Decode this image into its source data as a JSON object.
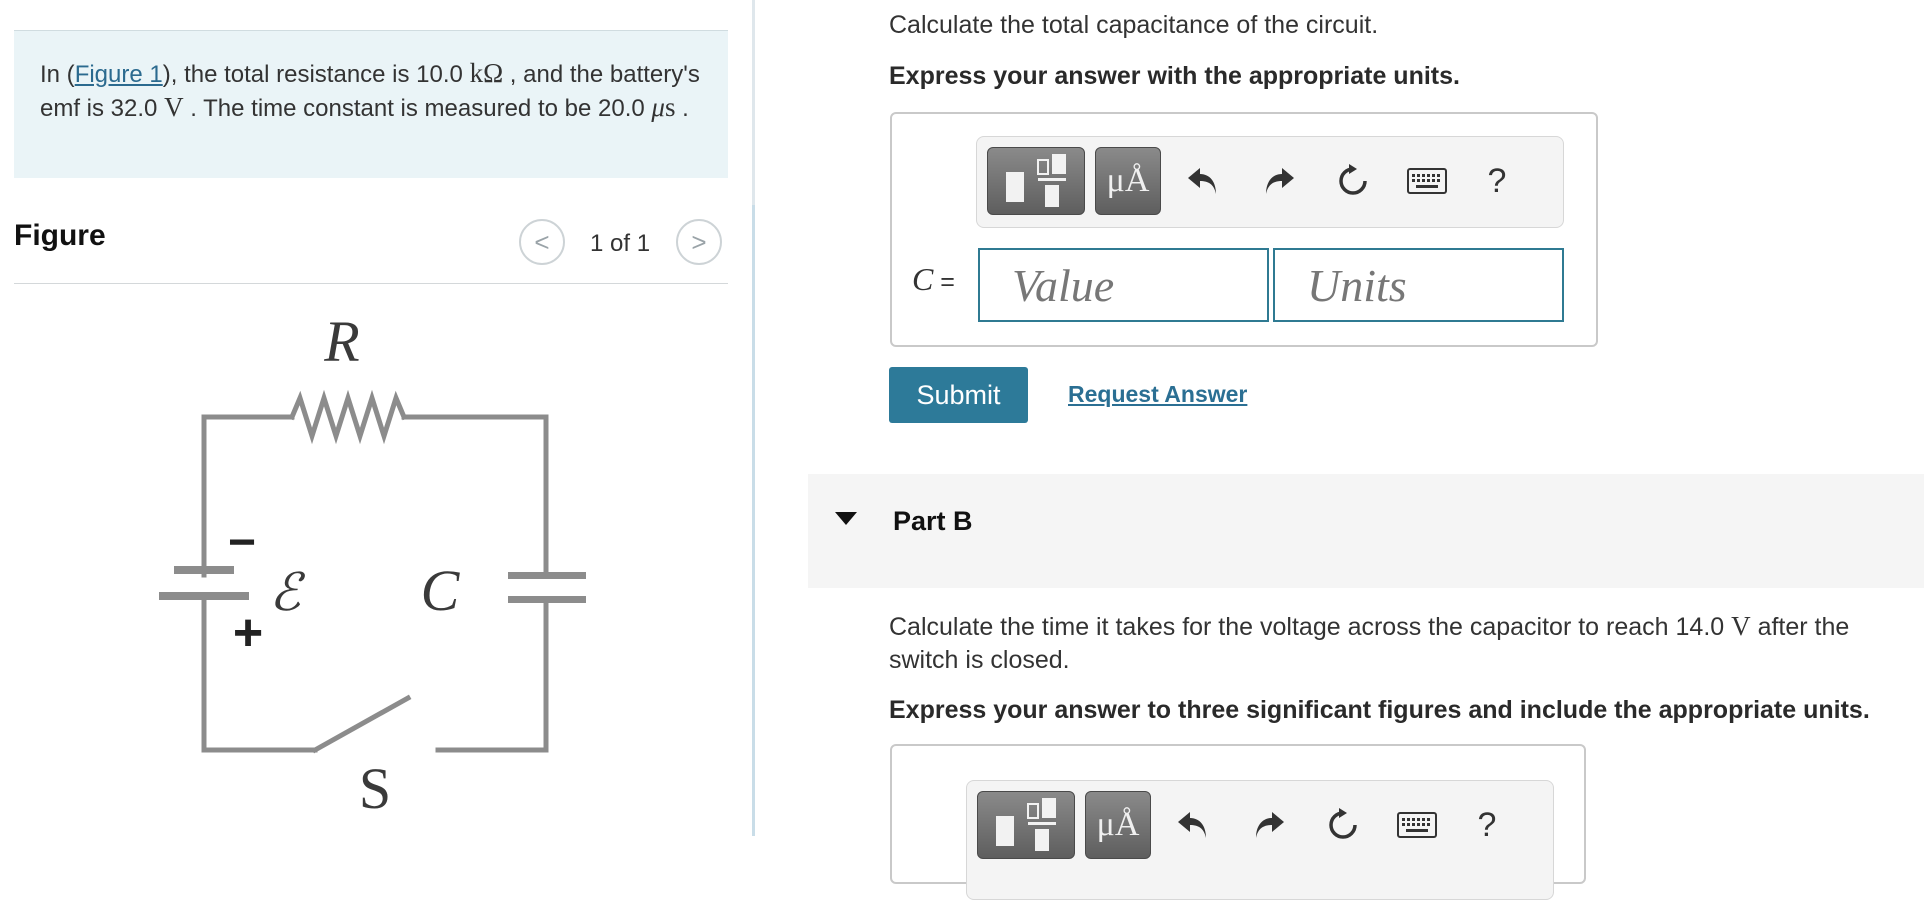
{
  "problem": {
    "text_in": "In (",
    "figure_link": "Figure 1",
    "text_after_link": "), the total resistance is 10.0 ",
    "resistance_unit": "kΩ",
    "text_emf": " , and the battery's emf is 32.0 ",
    "emf_unit": "V",
    "text_tc": " . The time constant is measured to be 20.0 ",
    "time_unit_mu": "μ",
    "time_unit_s": "s",
    "text_end": " ."
  },
  "figure": {
    "title": "Figure",
    "counter": "1 of 1",
    "prev": "<",
    "next": ">",
    "labels": {
      "R": "R",
      "C": "C",
      "emf": "ℰ",
      "S": "S",
      "minus": "−",
      "plus": "+"
    }
  },
  "part_a": {
    "question": "Calculate the total capacitance of the circuit.",
    "instruction": "Express your answer with the appropriate units.",
    "toolbar": {
      "units_btn": "μÅ",
      "help": "?"
    },
    "variable": "C",
    "equals": " =",
    "value_placeholder": "Value",
    "units_placeholder": "Units",
    "submit": "Submit",
    "request_answer": "Request Answer"
  },
  "part_b": {
    "title": "Part B",
    "question_start": "Calculate the time it takes for the voltage across the capacitor to reach 14.0 ",
    "question_unit": "V",
    "question_end": " after the switch is closed.",
    "instruction": "Express your answer to three significant figures and include the appropriate units.",
    "toolbar": {
      "units_btn": "μÅ",
      "help": "?"
    }
  },
  "colors": {
    "accent": "#2d7a99",
    "link": "#2b6a8f",
    "problem_bg": "#eaf4f7"
  }
}
